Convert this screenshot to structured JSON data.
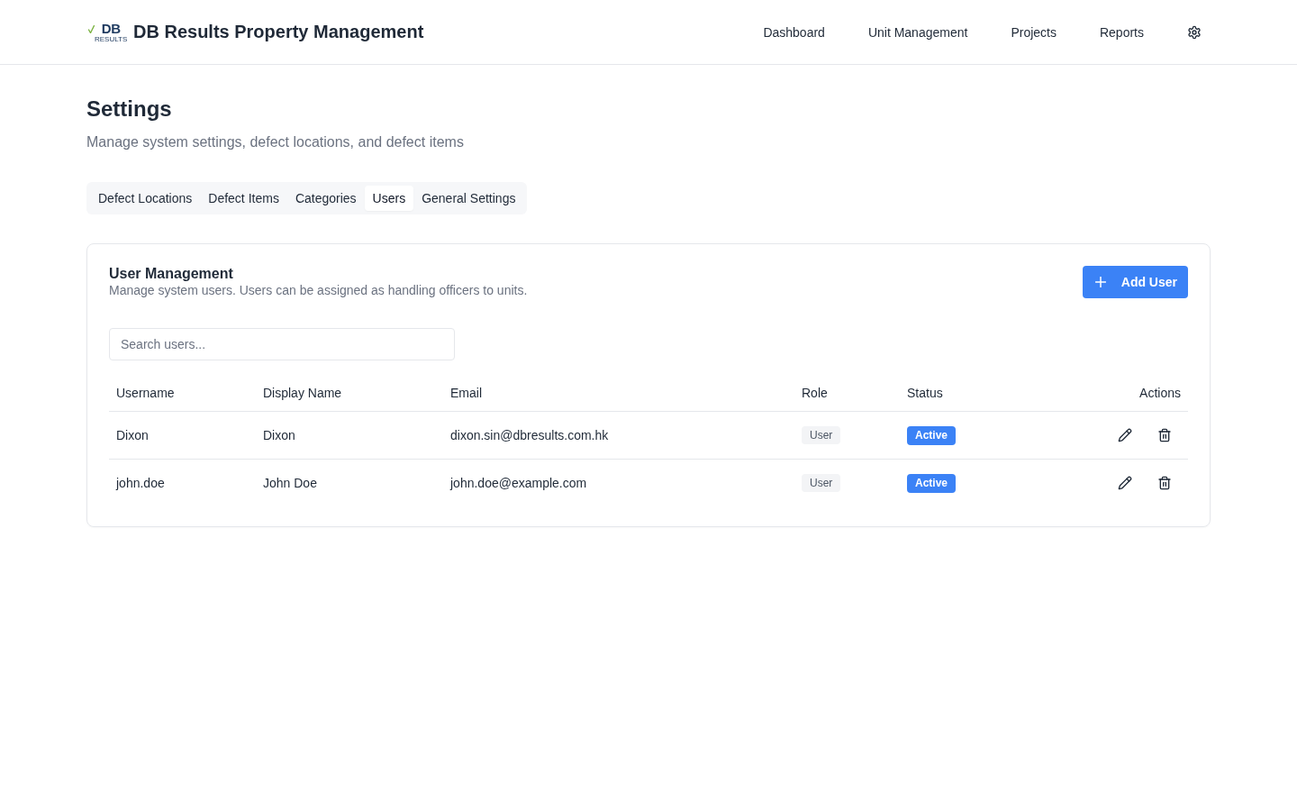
{
  "header": {
    "logo": {
      "mark": "DB",
      "subtext": "RESULTS"
    },
    "title": "DB Results Property Management",
    "nav": [
      {
        "label": "Dashboard"
      },
      {
        "label": "Unit Management"
      },
      {
        "label": "Projects"
      },
      {
        "label": "Reports"
      }
    ]
  },
  "page": {
    "title": "Settings",
    "subtitle": "Manage system settings, defect locations, and defect items"
  },
  "tabs": [
    {
      "label": "Defect Locations",
      "selected": false
    },
    {
      "label": "Defect Items",
      "selected": false
    },
    {
      "label": "Categories",
      "selected": false
    },
    {
      "label": "Users",
      "selected": true
    },
    {
      "label": "General Settings",
      "selected": false
    }
  ],
  "card": {
    "title": "User Management",
    "subtitle": "Manage system users. Users can be assigned as handling officers to units.",
    "add_button": {
      "label": "Add User"
    },
    "search": {
      "placeholder": "Search users..."
    },
    "table": {
      "columns": [
        "Username",
        "Display Name",
        "Email",
        "Role",
        "Status",
        "Actions"
      ],
      "rows": [
        {
          "username": "Dixon",
          "display_name": "Dixon",
          "email": "dixon.sin@dbresults.com.hk",
          "role": "User",
          "status": "Active"
        },
        {
          "username": "john.doe",
          "display_name": "John Doe",
          "email": "john.doe@example.com",
          "role": "User",
          "status": "Active"
        }
      ]
    }
  }
}
